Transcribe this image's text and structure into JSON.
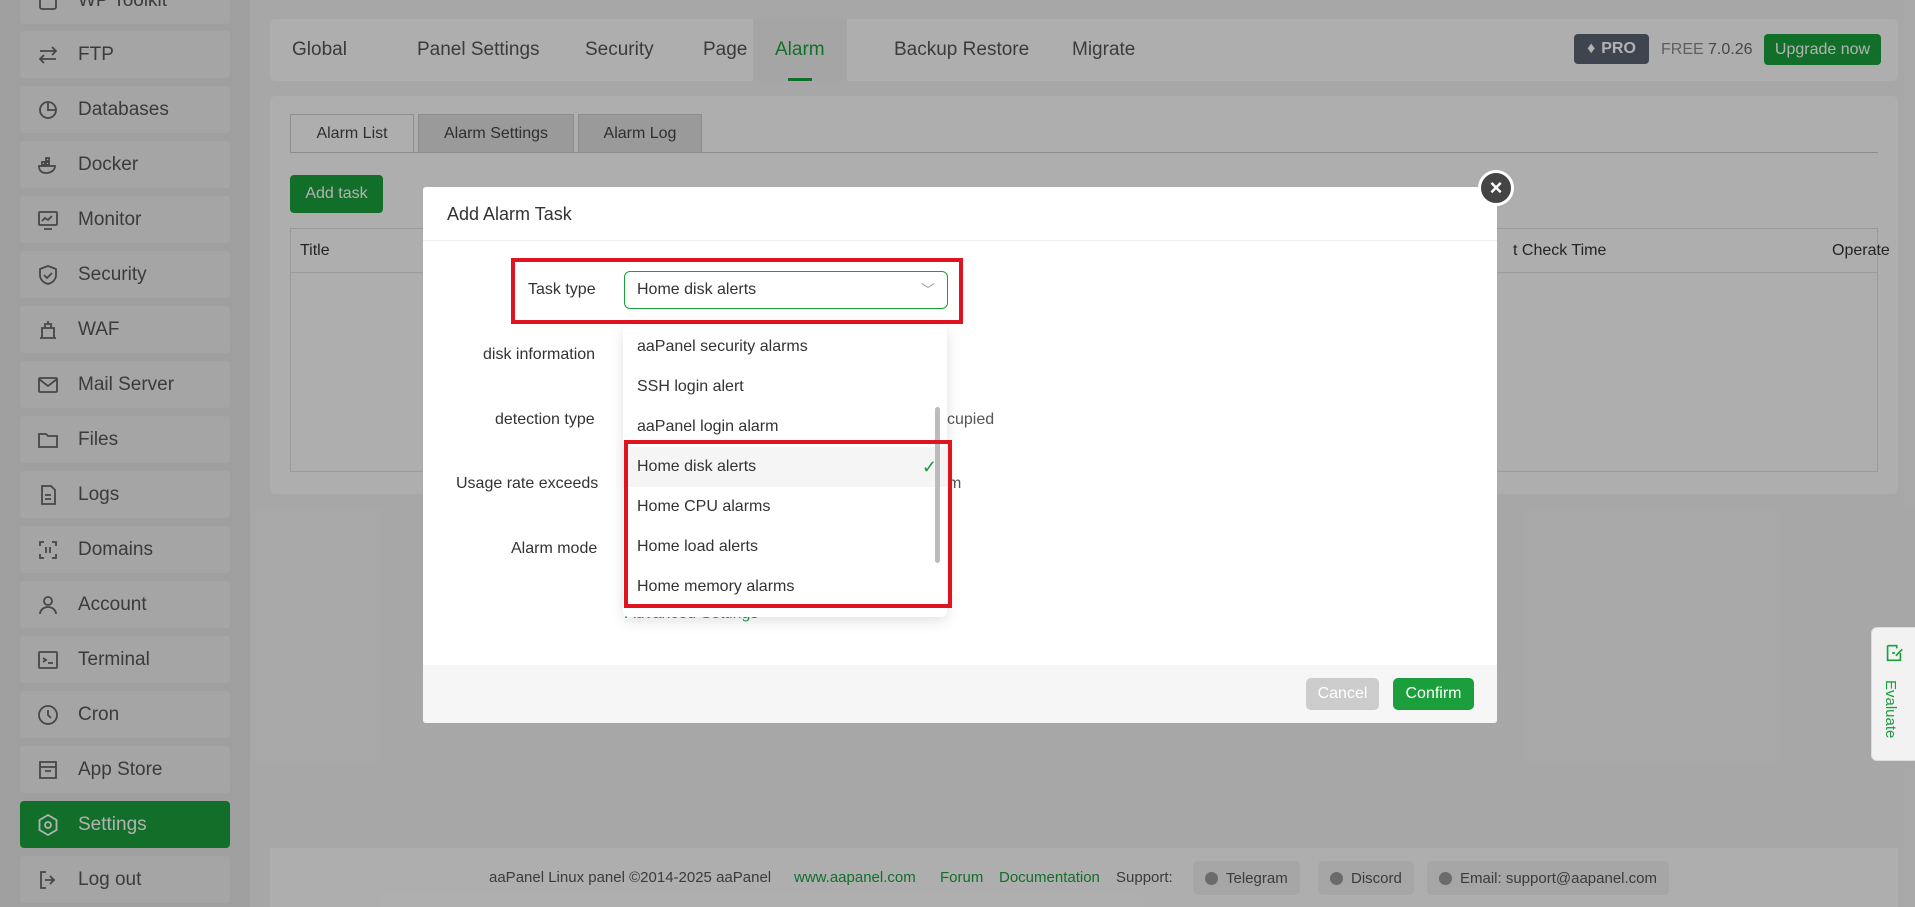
{
  "sidebar": {
    "items": [
      {
        "label": "WP Toolkit",
        "icon": "wp-toolkit-icon"
      },
      {
        "label": "FTP",
        "icon": "ftp-icon"
      },
      {
        "label": "Databases",
        "icon": "database-icon"
      },
      {
        "label": "Docker",
        "icon": "docker-icon"
      },
      {
        "label": "Monitor",
        "icon": "monitor-icon"
      },
      {
        "label": "Security",
        "icon": "shield-icon"
      },
      {
        "label": "WAF",
        "icon": "waf-icon"
      },
      {
        "label": "Mail Server",
        "icon": "mail-icon"
      },
      {
        "label": "Files",
        "icon": "folder-icon"
      },
      {
        "label": "Logs",
        "icon": "logs-icon"
      },
      {
        "label": "Domains",
        "icon": "domains-icon"
      },
      {
        "label": "Account",
        "icon": "user-icon"
      },
      {
        "label": "Terminal",
        "icon": "terminal-icon"
      },
      {
        "label": "Cron",
        "icon": "clock-icon"
      },
      {
        "label": "App Store",
        "icon": "store-icon"
      },
      {
        "label": "Settings",
        "icon": "settings-icon",
        "active": true
      },
      {
        "label": "Log out",
        "icon": "logout-icon"
      }
    ]
  },
  "topbar": {
    "tabs": [
      "Global",
      "Panel Settings",
      "Security",
      "Page",
      "Alarm",
      "Backup Restore",
      "Migrate"
    ],
    "active_tab": "Alarm",
    "pro_label": "PRO",
    "free_label": "FREE",
    "version": "7.0.26",
    "upgrade_label": "Upgrade now"
  },
  "main": {
    "subtabs": [
      "Alarm List",
      "Alarm Settings",
      "Alarm Log"
    ],
    "add_task_label": "Add task",
    "table_headers": {
      "title": "Title",
      "check_time": "t Check Time",
      "operate": "Operate"
    }
  },
  "modal": {
    "title": "Add Alarm Task",
    "fields": {
      "task_type": "Task type",
      "disk_information": "disk information",
      "detection_type": "detection type",
      "usage_rate": "Usage rate exceeds",
      "alarm_mode": "Alarm mode"
    },
    "task_type_value": "Home disk alerts",
    "detection_tail": "cupied",
    "usage_tail": "m",
    "advanced_settings": "Advanced Settings",
    "cancel_label": "Cancel",
    "confirm_label": "Confirm"
  },
  "dropdown": {
    "options": [
      "aaPanel security alarms",
      "SSH login alert",
      "aaPanel login alarm",
      "Home disk alerts",
      "Home CPU alarms",
      "Home load alerts",
      "Home memory alarms"
    ],
    "selected": "Home disk alerts"
  },
  "footer": {
    "copyright": "aaPanel Linux panel ©2014-2025 aaPanel",
    "site_link": "www.aapanel.com",
    "forum_link": "Forum",
    "docs_link": "Documentation",
    "support_label": "Support:",
    "telegram": "Telegram",
    "discord": "Discord",
    "email": "Email: support@aapanel.com"
  },
  "evaluate_label": "Evaluate",
  "colors": {
    "accent": "#1a9f3c",
    "highlight": "#e0141f",
    "pro_badge": "#5b6470"
  }
}
